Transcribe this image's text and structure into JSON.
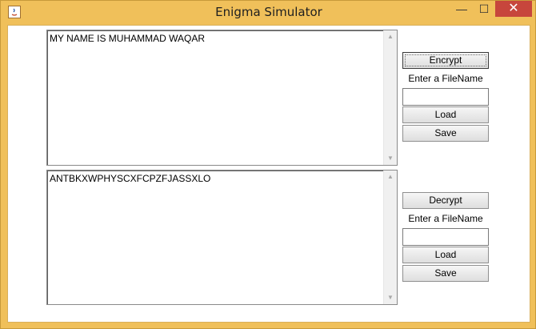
{
  "window": {
    "title": "Enigma Simulator",
    "controls": {
      "minimize": "—",
      "maximize": "☐",
      "close": "✕"
    }
  },
  "encrypt_panel": {
    "textarea_value": "MY NAME IS MUHAMMAD WAQAR",
    "button": "Encrypt",
    "filename_label": "Enter a FileName",
    "filename_value": "",
    "load": "Load",
    "save": "Save"
  },
  "decrypt_panel": {
    "textarea_value": "ANTBKXWPHYSCXFCPZFJASSXLO",
    "button": "Decrypt",
    "filename_label": "Enter a FileName",
    "filename_value": "",
    "load": "Load",
    "save": "Save"
  },
  "scroll_icons": {
    "up": "▲",
    "down": "▼"
  },
  "colors": {
    "frame": "#f0c05a",
    "close": "#c7463c"
  }
}
